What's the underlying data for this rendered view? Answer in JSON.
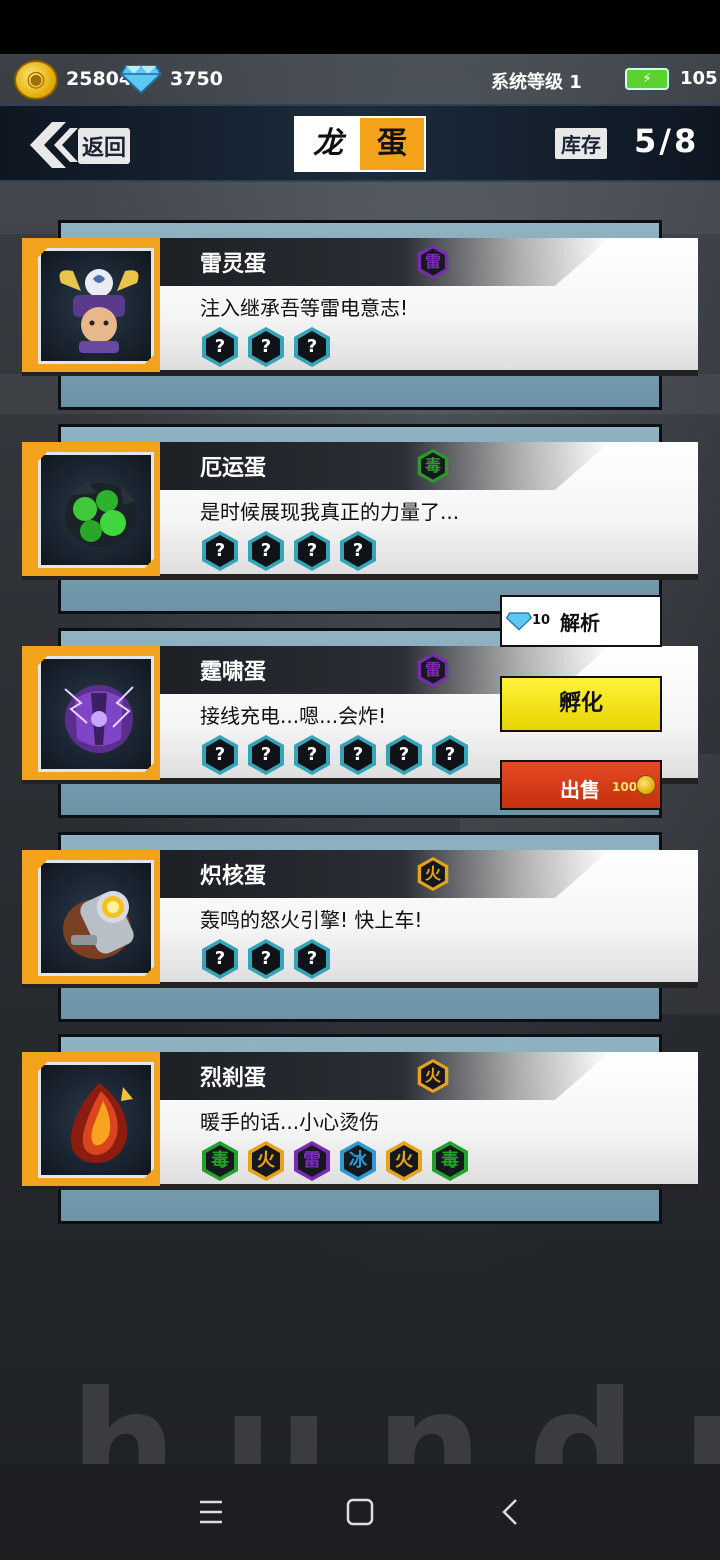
{
  "top": {
    "coins": "25804",
    "gems": "3750",
    "system_level": "系统等级 1",
    "energy": "105"
  },
  "header": {
    "back_label": "返回",
    "title_left": "龙",
    "title_right": "蛋",
    "stock_label": "库存",
    "stock_value": "5/8"
  },
  "eggs": [
    {
      "name": "雷灵蛋",
      "type": "雷",
      "type_color": "#7a2bb6",
      "desc": "注入继承吾等雷电意志!",
      "slots": [
        "?",
        "?",
        "?"
      ]
    },
    {
      "name": "厄运蛋",
      "type": "毒",
      "type_color": "#2f9a2a",
      "desc": "是时候展现我真正的力量了...",
      "slots": [
        "?",
        "?",
        "?",
        "?"
      ]
    },
    {
      "name": "霆啸蛋",
      "type": "雷",
      "type_color": "#7a2bb6",
      "desc": "接线充电...嗯...会炸!",
      "slots": [
        "?",
        "?",
        "?",
        "?",
        "?",
        "?"
      ]
    },
    {
      "name": "炽核蛋",
      "type": "火",
      "type_color": "#e8a21c",
      "desc": "轰鸣的怒火引擎! 快上车!",
      "slots": [
        "?",
        "?",
        "?"
      ]
    },
    {
      "name": "烈刹蛋",
      "type": "火",
      "type_color": "#e8a21c",
      "desc": "暖手的话...小心烫伤",
      "slots": [
        "毒",
        "火",
        "雷",
        "冰",
        "火",
        "毒"
      ]
    }
  ],
  "actions": {
    "analyze_cost": "10",
    "analyze_label": "解析",
    "hatch_label": "孵化",
    "sell_label": "出售",
    "sell_price": "100"
  },
  "background_text": "hundr",
  "icons": {
    "back": "chevron-back-icon",
    "coin": "coin-icon",
    "gem": "diamond-icon",
    "battery": "battery-icon"
  }
}
